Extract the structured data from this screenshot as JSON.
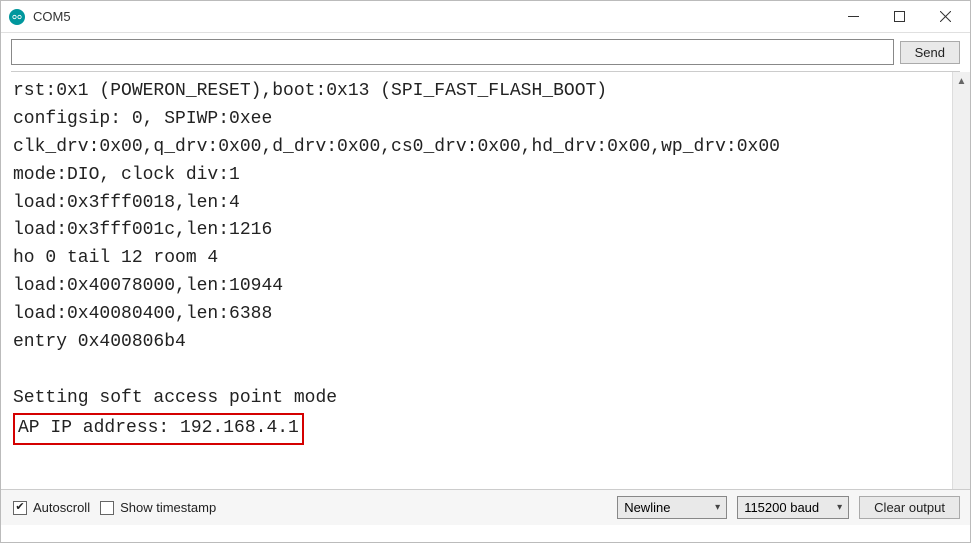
{
  "window": {
    "title": "COM5"
  },
  "input": {
    "value": "",
    "send_label": "Send"
  },
  "console": {
    "lines": [
      "rst:0x1 (POWERON_RESET),boot:0x13 (SPI_FAST_FLASH_BOOT)",
      "configsip: 0, SPIWP:0xee",
      "clk_drv:0x00,q_drv:0x00,d_drv:0x00,cs0_drv:0x00,hd_drv:0x00,wp_drv:0x00",
      "mode:DIO, clock div:1",
      "load:0x3fff0018,len:4",
      "load:0x3fff001c,len:1216",
      "ho 0 tail 12 room 4",
      "load:0x40078000,len:10944",
      "load:0x40080400,len:6388",
      "entry 0x400806b4",
      "",
      "Setting soft access point mode"
    ],
    "highlight_line": "AP IP address: 192.168.4.1"
  },
  "bottom": {
    "autoscroll_label": "Autoscroll",
    "autoscroll_checked": true,
    "timestamp_label": "Show timestamp",
    "timestamp_checked": false,
    "line_ending": "Newline",
    "baud": "115200 baud",
    "clear_label": "Clear output"
  }
}
